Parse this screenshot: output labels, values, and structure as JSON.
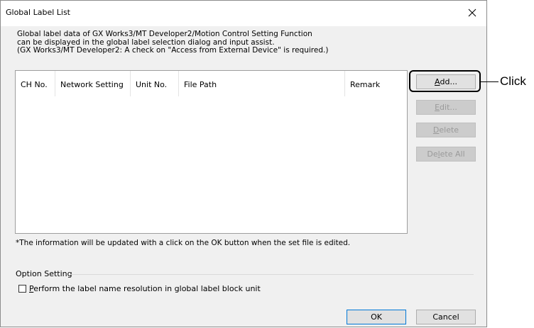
{
  "window": {
    "title": "Global Label List"
  },
  "description": {
    "line1": "Global label data of GX Works3/MT Developer2/Motion Control Setting Function",
    "line2": "can be displayed in the global label selection dialog and input assist.",
    "line3": "(GX Works3/MT Developer2: A check on \"Access from External Device\" is required.)"
  },
  "table": {
    "columns": [
      "CH No.",
      "Network Setting",
      "Unit No.",
      "File Path",
      "Remark"
    ],
    "rows": []
  },
  "buttons": {
    "add": {
      "label": "Add...",
      "mnemonic": "A",
      "rest": "dd...",
      "enabled": true
    },
    "edit": {
      "label": "Edit...",
      "mnemonic": "E",
      "rest": "dit...",
      "enabled": false
    },
    "delete": {
      "label": "Delete",
      "mnemonic": "D",
      "rest": "elete",
      "enabled": false
    },
    "delete_all": {
      "label": "Delete All",
      "before": "De",
      "mnemonic": "l",
      "after": "ete All",
      "enabled": false
    },
    "ok": "OK",
    "cancel": "Cancel"
  },
  "note": "*The information will be updated with a click on the OK button when the set file is edited.",
  "option_setting": {
    "group_label": "Option Setting",
    "checkbox": {
      "mnemonic": "P",
      "rest": "erform the label name resolution in global label block unit",
      "checked": false
    }
  },
  "annotation": {
    "callout_text": "Click"
  }
}
